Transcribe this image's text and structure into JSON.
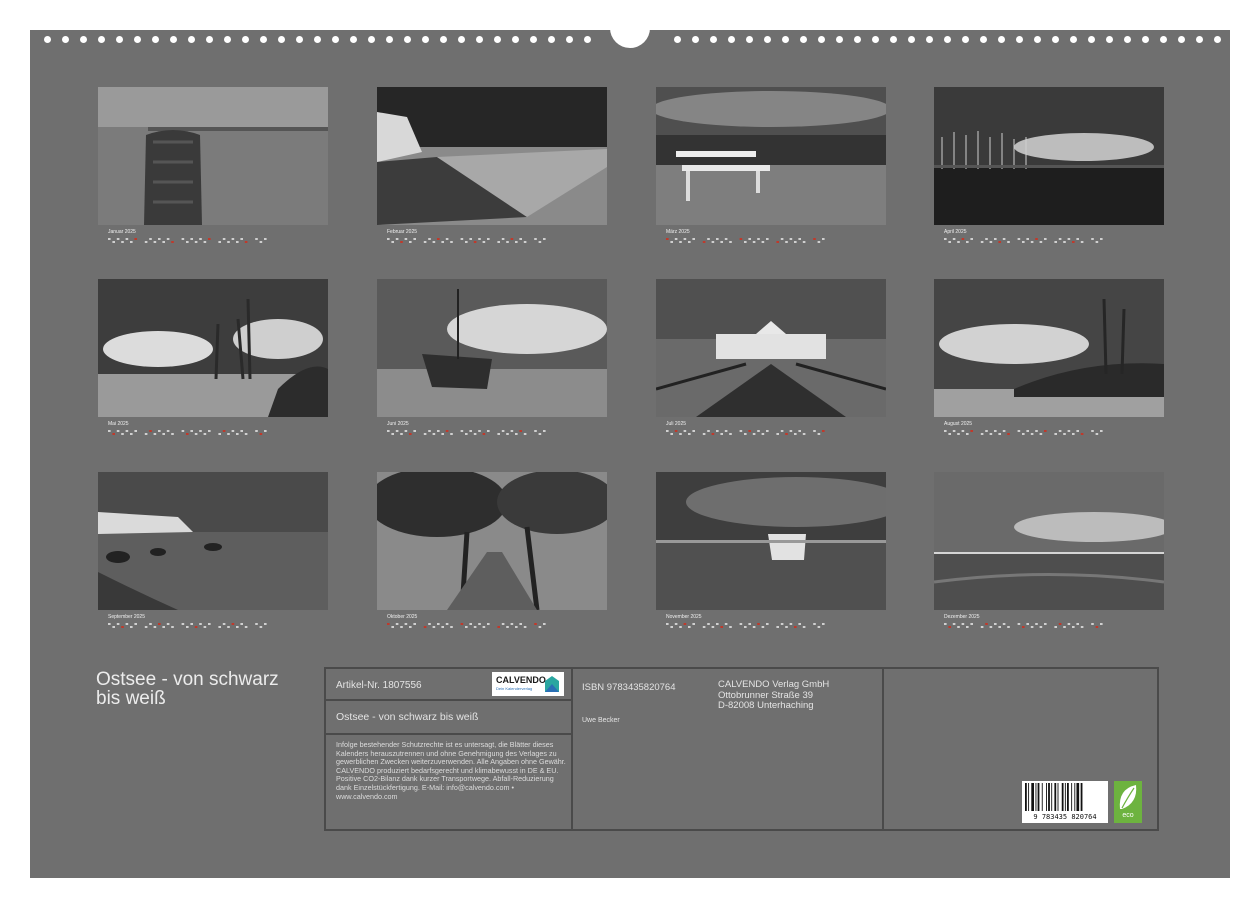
{
  "calendar_title": [
    "Ostsee - von schwarz",
    "bis weiß"
  ],
  "months": [
    {
      "name": "Januar",
      "year": "2025",
      "photo": "wooden-post-sea-photo"
    },
    {
      "name": "Februar",
      "year": "2025",
      "photo": "chalk-cliff-beach-photo"
    },
    {
      "name": "März",
      "year": "2025",
      "photo": "beach-bench-photo"
    },
    {
      "name": "April",
      "year": "2025",
      "photo": "harbor-sailboats-photo"
    },
    {
      "name": "Mai",
      "year": "2025",
      "photo": "dune-trees-photo"
    },
    {
      "name": "Juni",
      "year": "2025",
      "photo": "fishing-boat-beach-photo"
    },
    {
      "name": "Juli",
      "year": "2025",
      "photo": "pier-building-photo"
    },
    {
      "name": "August",
      "year": "2025",
      "photo": "coast-forest-photo"
    },
    {
      "name": "September",
      "year": "2025",
      "photo": "cliff-rocks-sea-photo"
    },
    {
      "name": "Oktober",
      "year": "2025",
      "photo": "tree-avenue-photo"
    },
    {
      "name": "November",
      "year": "2025",
      "photo": "boat-on-shore-photo"
    },
    {
      "name": "Dezember",
      "year": "2025",
      "photo": "calm-sea-horizon-photo"
    }
  ],
  "info": {
    "article_label": "Artikel-Nr. 1807556",
    "title": "Ostsee - von schwarz bis weiß",
    "legal_text": "Infolge bestehender Schutzrechte ist es untersagt, die Blätter dieses Kalenders herauszutrennen und ohne Genehmigung des Verlages zu gewerblichen Zwecken weiterzuverwenden. Alle Angaben ohne Gewähr. CALVENDO produziert bedarfsgerecht und klimabewusst in DE & EU. Positive CO2-Bilanz dank kurzer Transportwege. Abfall-Reduzierung dank Einzelstückfertigung. E-Mail: info@calvendo.com • www.calvendo.com",
    "isbn": "ISBN 9783435820764",
    "author": "Uwe Becker",
    "publisher": [
      "CALVENDO Verlag GmbH",
      "Ottobrunner Straße 39",
      "D-82008 Unterhaching"
    ],
    "logo_text": "CALVENDO",
    "logo_subtext": "Dein Kalenderverlag",
    "barcode_number": "9 783435 820764",
    "eco_label": "eco"
  },
  "colors": {
    "sheet": "#6f6f6f",
    "accent_red": "#c0392b",
    "eco_green": "#6db33f"
  }
}
